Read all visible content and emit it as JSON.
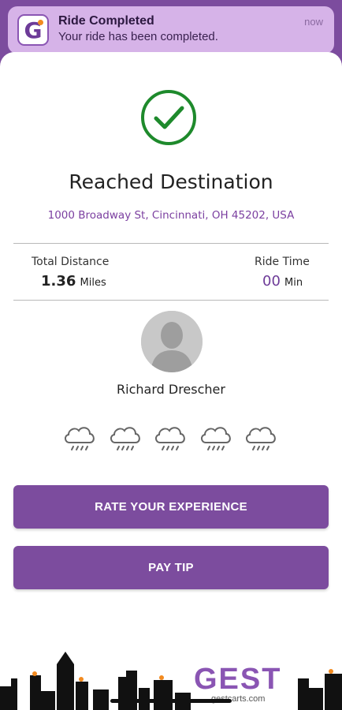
{
  "notification": {
    "app_icon_letter": "G",
    "title": "Ride Completed",
    "body": "Your ride has been completed.",
    "time": "now"
  },
  "status": {
    "icon": "checkmark-circle-icon",
    "heading": "Reached Destination",
    "address": "1000 Broadway St, Cincinnati, OH 45202, USA"
  },
  "stats": {
    "distance_label": "Total Distance",
    "distance_value": "1.36",
    "distance_unit": "Miles",
    "time_label": "Ride Time",
    "time_value": "00",
    "time_unit": "Min"
  },
  "driver": {
    "name": "Richard Drescher",
    "avatar_icon": "person-silhouette-icon"
  },
  "rating": {
    "icon": "rain-cloud-icon",
    "count": 5,
    "selected": 0
  },
  "buttons": {
    "rate": "RATE YOUR EXPERIENCE",
    "tip": "PAY TIP"
  },
  "footer": {
    "brand": "GEST",
    "url": "gestcarts.com"
  },
  "colors": {
    "primary": "#7c4c9e",
    "notification_bg": "#d6b3e8",
    "check_green": "#1e8a2c",
    "address_purple": "#7b3fa0",
    "accent_orange": "#f28a1f"
  }
}
